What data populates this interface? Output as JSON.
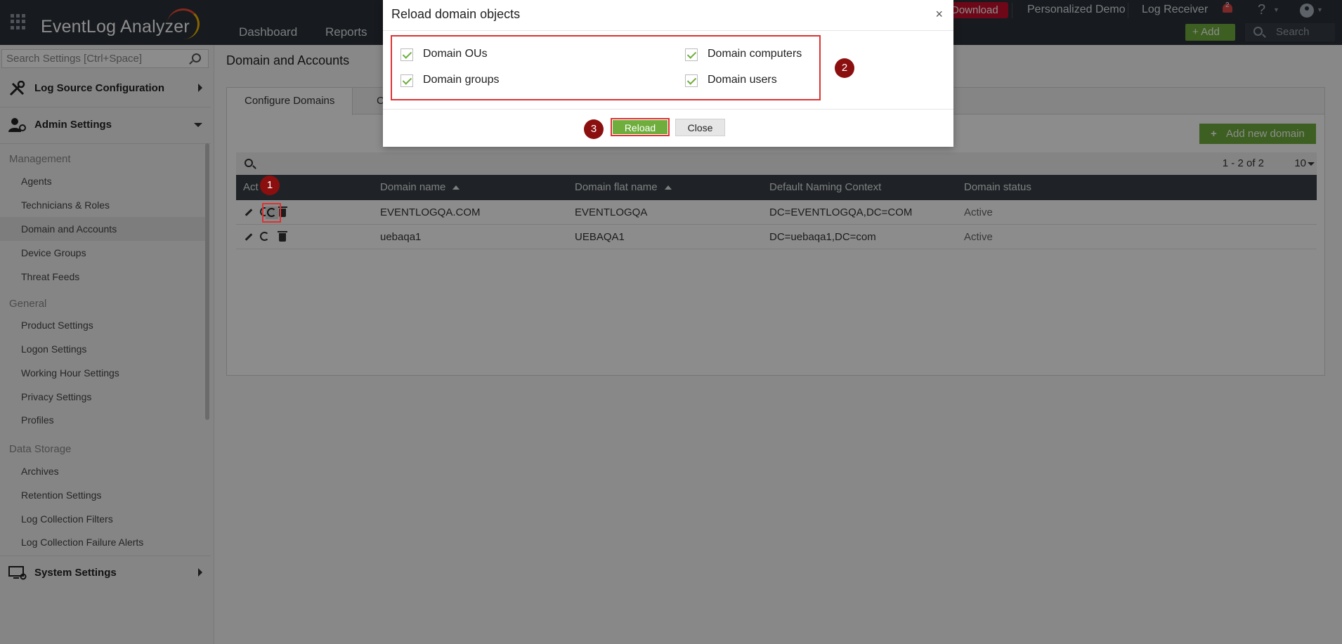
{
  "header": {
    "app_name": "EventLog Analyzer",
    "nav": [
      "Dashboard",
      "Reports"
    ],
    "download_label": "Download",
    "links": [
      "Personalized Demo",
      "Log Receiver"
    ],
    "notification_count": "2",
    "help_label": "?",
    "add_label": "+ Add",
    "search_placeholder": "Search"
  },
  "sidebar": {
    "search_placeholder": "Search Settings [Ctrl+Space]",
    "groups": [
      {
        "label": "Log Source Configuration"
      },
      {
        "label": "Admin Settings"
      },
      {
        "label": "System Settings"
      }
    ],
    "sections": [
      {
        "title": "Management",
        "items": [
          "Agents",
          "Technicians & Roles",
          "Domain and Accounts",
          "Device Groups",
          "Threat Feeds"
        ]
      },
      {
        "title": "General",
        "items": [
          "Product Settings",
          "Logon Settings",
          "Working Hour Settings",
          "Privacy Settings",
          "Profiles"
        ]
      },
      {
        "title": "Data Storage",
        "items": [
          "Archives",
          "Retention Settings",
          "Log Collection Filters",
          "Log Collection Failure Alerts"
        ]
      }
    ],
    "active_item": "Domain and Accounts"
  },
  "main": {
    "title": "Domain and Accounts",
    "tabs": [
      "Configure Domains",
      "C"
    ],
    "add_domain_label": "Add new domain",
    "pager": "1 - 2 of 2",
    "page_size": "10",
    "columns": [
      "Act",
      "Domain name",
      "Domain flat name",
      "Default Naming Context",
      "Domain status"
    ],
    "rows": [
      {
        "domain": "EVENTLOGQA.COM",
        "flat": "EVENTLOGQA",
        "context": "DC=EVENTLOGQA,DC=COM",
        "status": "Active"
      },
      {
        "domain": "uebaqa1",
        "flat": "UEBAQA1",
        "context": "DC=uebaqa1,DC=com",
        "status": "Active"
      }
    ]
  },
  "modal": {
    "title": "Reload domain objects",
    "close_symbol": "×",
    "options": [
      "Domain OUs",
      "Domain computers",
      "Domain groups",
      "Domain users"
    ],
    "reload_label": "Reload",
    "close_label": "Close"
  },
  "annotations": [
    "1",
    "2",
    "3"
  ],
  "colors": {
    "topbar": "#2b3138",
    "accent_green": "#6fae3d",
    "highlight_red": "#dd3333",
    "badge": "#8b0f0f"
  }
}
